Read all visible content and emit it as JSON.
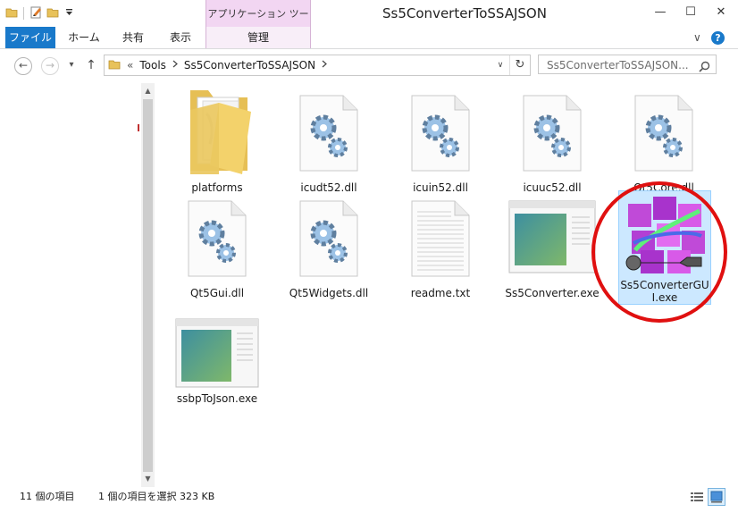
{
  "window": {
    "title": "Ss5ConverterToSSAJSON",
    "context_tab_header": "アプリケーション ツール",
    "minimize_glyph": "—",
    "maximize_glyph": "☐",
    "close_glyph": "✕"
  },
  "ribbon": {
    "tabs": [
      {
        "label": "ファイル"
      },
      {
        "label": "ホーム"
      },
      {
        "label": "共有"
      },
      {
        "label": "表示"
      },
      {
        "label": "管理"
      }
    ],
    "expand_glyph": "∨",
    "help_glyph": "?"
  },
  "navigation": {
    "back_glyph": "←",
    "forward_glyph": "→",
    "recent_glyph": "▾",
    "up_glyph": "↑",
    "address": {
      "overflow": "«",
      "crumbs": [
        "Tools",
        "Ss5ConverterToSSAJSON"
      ]
    },
    "dropdown_glyph": "∨",
    "refresh_glyph": "↻",
    "search_placeholder": "Ss5ConverterToSSAJSON..."
  },
  "files": [
    {
      "name": "platforms",
      "type": "folder"
    },
    {
      "name": "icudt52.dll",
      "type": "dll"
    },
    {
      "name": "icuin52.dll",
      "type": "dll"
    },
    {
      "name": "icuuc52.dll",
      "type": "dll"
    },
    {
      "name": "Qt5Core.dll",
      "type": "dll"
    },
    {
      "name": "Qt5Gui.dll",
      "type": "dll"
    },
    {
      "name": "Qt5Widgets.dll",
      "type": "dll"
    },
    {
      "name": "readme.txt",
      "type": "txt"
    },
    {
      "name": "Ss5Converter.exe",
      "type": "exe"
    },
    {
      "name": "Ss5ConverterGUI.exe",
      "type": "app",
      "selected": true
    },
    {
      "name": "ssbpToJson.exe",
      "type": "exe"
    }
  ],
  "status": {
    "item_count": "11 個の項目",
    "selection": "1 個の項目を選択  323 KB"
  },
  "colors": {
    "accent": "#1979ca",
    "selection_fill": "#cce8ff",
    "highlight_circle": "#e01010",
    "context_tab": "#f2d6f2"
  }
}
